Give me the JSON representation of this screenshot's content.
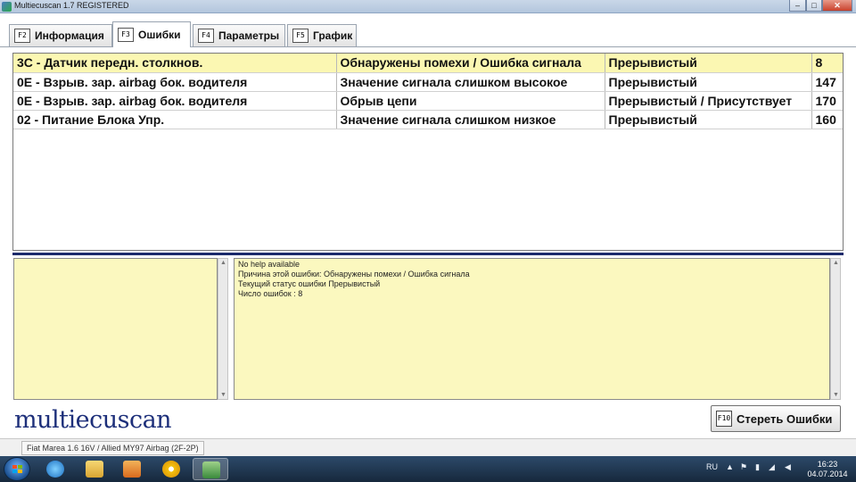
{
  "window": {
    "title": "Multiecuscan 1.7 REGISTERED",
    "minimize": "–",
    "maximize": "□",
    "close": "✕"
  },
  "tabs": [
    {
      "key": "F2",
      "label": "Информация"
    },
    {
      "key": "F3",
      "label": "Ошибки"
    },
    {
      "key": "F4",
      "label": "Параметры"
    },
    {
      "key": "F5",
      "label": "График"
    }
  ],
  "faults": [
    {
      "code": "3C - Датчик передн. столкнов.",
      "description": "Обнаружены помехи / Ошибка сигнала",
      "status": "Прерывистый",
      "count": "8"
    },
    {
      "code": "0E - Взрыв. зар. airbag бок. водителя",
      "description": "Значение сигнала слишком высокое",
      "status": "Прерывистый",
      "count": "147"
    },
    {
      "code": "0E - Взрыв. зар. airbag бок. водителя",
      "description": "Обрыв цепи",
      "status": "Прерывистый / Присутствует",
      "count": "170"
    },
    {
      "code": "02 - Питание Блока Упр.",
      "description": "Значение сигнала слишком низкое",
      "status": "Прерывистый",
      "count": "160"
    }
  ],
  "help": {
    "lines": [
      "No help available",
      "Причина этой ошибки: Обнаружены помехи / Ошибка сигнала",
      "Текущий статус ошибки Прерывистый",
      "Число ошибок : 8"
    ]
  },
  "logo": "multiecuscan",
  "clear_button": {
    "key": "F10",
    "label": "Стереть Ошибки"
  },
  "status_bar": {
    "vehicle": "Fiat Marea 1.6 16V / Allied MY97 Airbag (2F-2P)"
  },
  "taskbar": {
    "language": "RU",
    "time": "16:23",
    "date": "04.07.2014"
  },
  "colors": {
    "selected_row": "#fbf7b2",
    "panel_yellow": "#fbf8bf",
    "logo_blue": "#1d2f7a"
  }
}
